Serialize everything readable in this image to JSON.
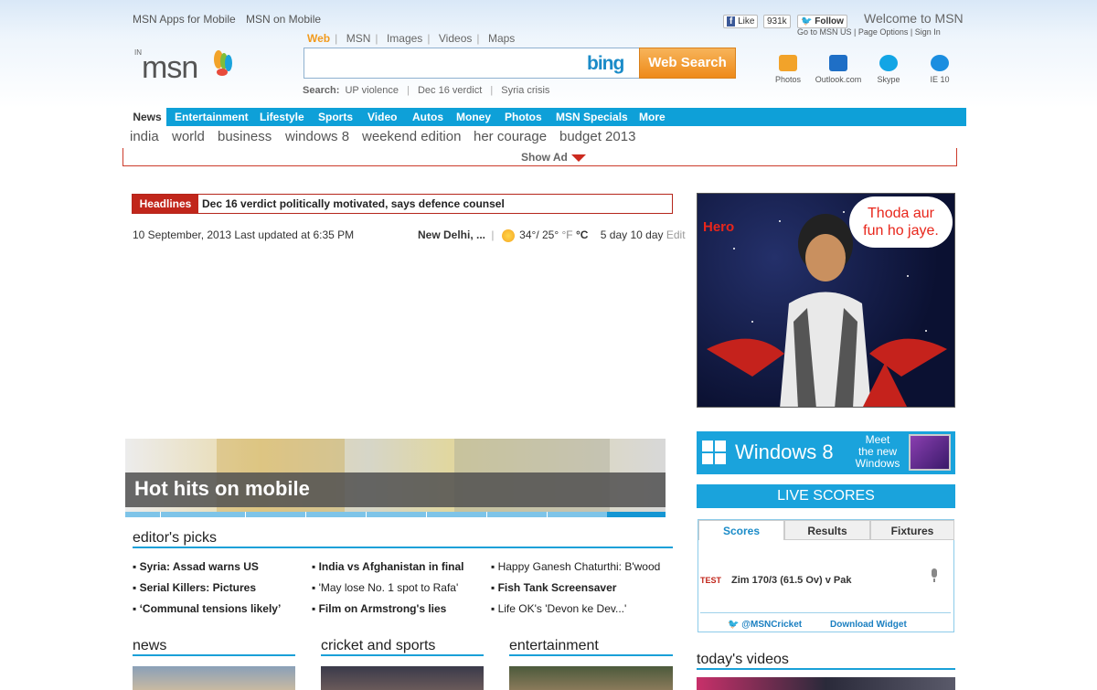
{
  "header": {
    "toplinks": [
      "MSN Apps for Mobile",
      "MSN on Mobile"
    ],
    "region": "IN",
    "logo": "msn",
    "facebook_like": "Like",
    "facebook_count": "931k",
    "twitter_follow": "Follow",
    "welcome": "Welcome to MSN",
    "account_links": [
      "Go to MSN US",
      "Page Options",
      "Sign In"
    ]
  },
  "search": {
    "tabs": [
      "Web",
      "MSN",
      "Images",
      "Videos",
      "Maps"
    ],
    "active_tab": "Web",
    "value": "",
    "brand": "bing",
    "button": "Web Search",
    "suggest_label": "Search:",
    "suggestions": [
      "UP violence",
      "Dec 16 verdict",
      "Syria crisis"
    ]
  },
  "tray": [
    {
      "label": "Photos",
      "icon": "photos-icon",
      "color": "#f2a32a"
    },
    {
      "label": "Outlook.com",
      "icon": "outlook-icon",
      "color": "#1f6fc6"
    },
    {
      "label": "Skype",
      "icon": "skype-icon",
      "color": "#12a5e5"
    },
    {
      "label": "IE 10",
      "icon": "ie-icon",
      "color": "#1b8ee0"
    }
  ],
  "nav": [
    "News",
    "Entertainment",
    "Lifestyle",
    "Sports",
    "Video",
    "Autos",
    "Money",
    "Photos",
    "MSN Specials",
    "More"
  ],
  "subnav": [
    "india",
    "world",
    "business",
    "windows 8",
    "weekend edition",
    "her courage",
    "budget 2013"
  ],
  "showad": "Show Ad",
  "headlines": {
    "label": "Headlines",
    "text": "Dec 16 verdict politically motivated, says defence counsel"
  },
  "dateline": "10 September, 2013  Last updated at 6:35 PM",
  "weather": {
    "city": "New Delhi, ...",
    "temps": "34°/ 25°",
    "unit_f": "°F",
    "unit_c": "°C",
    "forecast5": "5 day",
    "forecast10": "10 day",
    "edit": "Edit"
  },
  "slider": {
    "caption": "Hot hits on mobile"
  },
  "editors_picks": {
    "title": "editor's picks",
    "col1": [
      "Syria: Assad warns US",
      "Serial Killers: Pictures",
      "‘Communal tensions likely’"
    ],
    "col2": [
      "India vs Afghanistan in final",
      "'May lose No. 1 spot to Rafa'",
      "Film on Armstrong's lies"
    ],
    "col3": [
      "Happy Ganesh Chaturthi: B'wood",
      "Fish Tank Screensaver",
      "Life OK's 'Devon ke Dev...'"
    ]
  },
  "sections": [
    "news",
    "cricket and sports",
    "entertainment"
  ],
  "ad": {
    "brand": "Hero",
    "bubble_line1": "Thoda aur",
    "bubble_line2": "fun ho jaye."
  },
  "win8": {
    "title": "Windows 8",
    "tag1": "Meet",
    "tag2": "the new",
    "tag3": "Windows"
  },
  "live_scores": {
    "title": "LIVE SCORES",
    "tabs": [
      "Scores",
      "Results",
      "Fixtures"
    ],
    "badge": "TEST",
    "match": "Zim 170/3 (61.5 Ov)   v   Pak",
    "twitter": "@MSNCricket",
    "download": "Download Widget"
  },
  "videos_title": "today's videos"
}
